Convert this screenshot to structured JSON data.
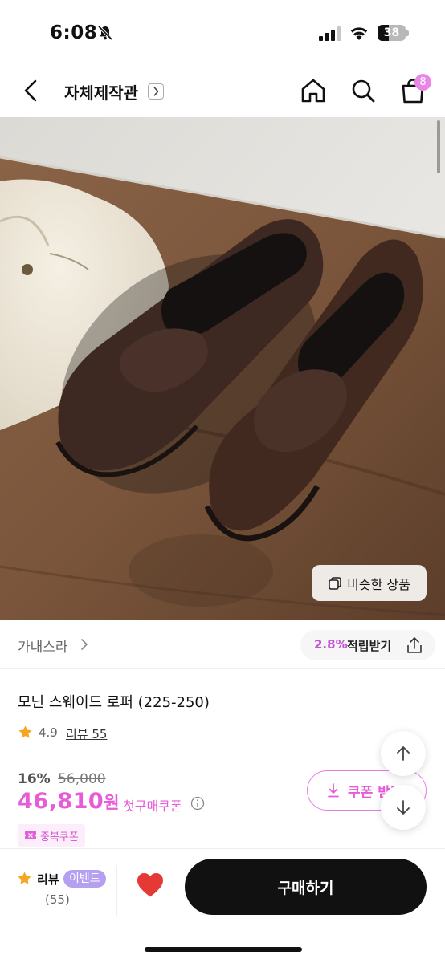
{
  "status_bar": {
    "time": "6:08",
    "battery": "38",
    "icons": [
      "bell-slash-icon",
      "signal-icon",
      "wifi-icon",
      "battery-icon"
    ]
  },
  "header": {
    "title": "자체제작관",
    "cart_count": "8",
    "icons": [
      "back-icon",
      "chevron-right-icon",
      "home-icon",
      "search-icon",
      "cart-icon"
    ]
  },
  "image": {
    "similar_button": "비슷한 상품"
  },
  "brand": {
    "name": "가내스라",
    "reward_percent": "2.8%",
    "reward_label": "적립받기"
  },
  "product": {
    "name": "모닌 스웨이드 로퍼 (225-250)",
    "rating": "4.9",
    "review_link": "리뷰 55",
    "discount": "16%",
    "original_price": "56,000",
    "price": "46,810",
    "price_unit": "원",
    "first_purchase_coupon": "첫구매쿠폰",
    "coupon_button": "쿠폰 받기",
    "duplicate_coupon": "중복쿠폰"
  },
  "bottom_bar": {
    "review_label": "리뷰",
    "event_badge": "이벤트",
    "review_count": "(55)",
    "buy_button": "구매하기"
  },
  "colors": {
    "accent_pink": "#e75ad8",
    "badge_pink": "#e987e6",
    "event_purple": "#b59ff0",
    "heart_red": "#e53935",
    "buy_button": "#111111"
  }
}
